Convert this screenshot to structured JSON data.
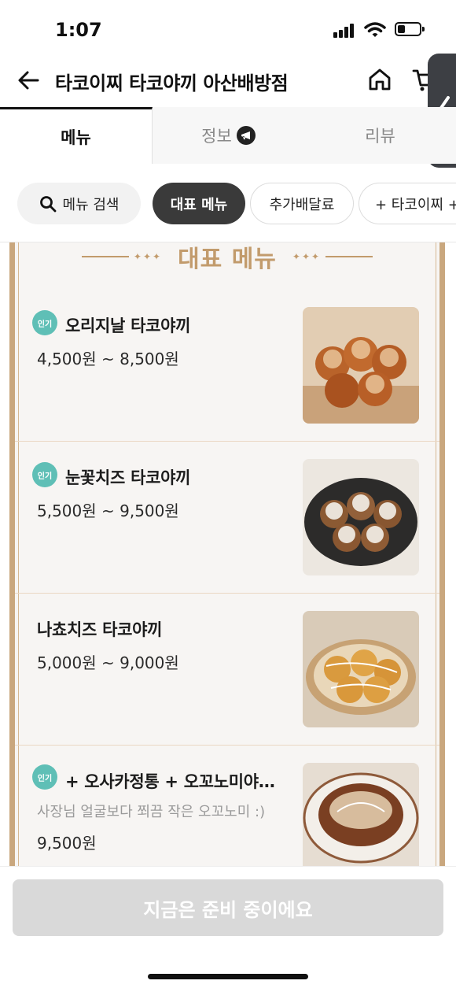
{
  "status": {
    "time": "1:07"
  },
  "header": {
    "title": "타코이찌 타코야끼 아산배방점"
  },
  "tabs": [
    {
      "label": "메뉴",
      "active": true
    },
    {
      "label": "정보",
      "active": false
    },
    {
      "label": "리뷰",
      "active": false
    }
  ],
  "chips": {
    "search": "메뉴 검색",
    "representative": "대표 메뉴",
    "delivery": "추가배달료",
    "extra": "+ 타코이찌 +"
  },
  "board": {
    "title": "대표 메뉴",
    "badge_text": "인기",
    "items": [
      {
        "name": "오리지날 타코야끼",
        "price": "4,500원 ~ 8,500원",
        "popular": true,
        "photo": "takoyaki-original"
      },
      {
        "name": "눈꽃치즈 타코야끼",
        "price": "5,500원 ~ 9,500원",
        "popular": true,
        "photo": "takoyaki-snow-cheese"
      },
      {
        "name": "나쵸치즈 타코야끼",
        "price": "5,000원 ~ 9,000원",
        "popular": false,
        "photo": "takoyaki-nacho-cheese"
      },
      {
        "name": "+ 오사카정통 + 오꼬노미야…",
        "desc": "사장님 얼굴보다 쬐끔 작은 오꼬노미 :)",
        "price": "9,500원",
        "popular": true,
        "photo": "okonomiyaki"
      }
    ]
  },
  "bottom": {
    "button_label": "지금은 준비 중이에요"
  },
  "colors": {
    "accent_gold": "#c29b6c",
    "badge_teal": "#5fbfb6",
    "chip_active": "#3a3a3a"
  }
}
